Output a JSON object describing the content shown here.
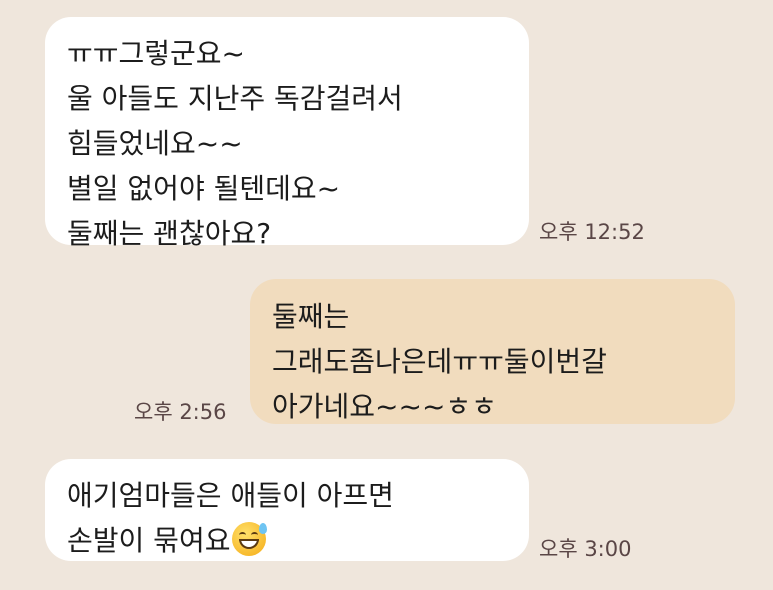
{
  "messages": [
    {
      "direction": "incoming",
      "lines": [
        "ㅠㅠ그렇군요~",
        "울 아들도 지난주 독감걸려서",
        "힘들었네요~~",
        "별일 없어야 될텐데요~",
        "둘째는 괜찮아요?"
      ],
      "time": "오후 12:52"
    },
    {
      "direction": "outgoing",
      "lines": [
        "둘째는",
        "그래도좀나은데ㅠㅠ둘이번갈",
        "아가네요~~~ㅎㅎ"
      ],
      "time": "오후 2:56"
    },
    {
      "direction": "incoming",
      "lines": [
        "애기엄마들은 애들이 아프면",
        "손발이 묶여요"
      ],
      "emoji": "grinning-face-with-sweat-icon",
      "time": "오후 3:00"
    }
  ],
  "colors": {
    "background": "#efe6dc",
    "incoming_bubble": "#ffffff",
    "outgoing_bubble": "#f1dcbe",
    "timestamp": "#5a4646"
  }
}
